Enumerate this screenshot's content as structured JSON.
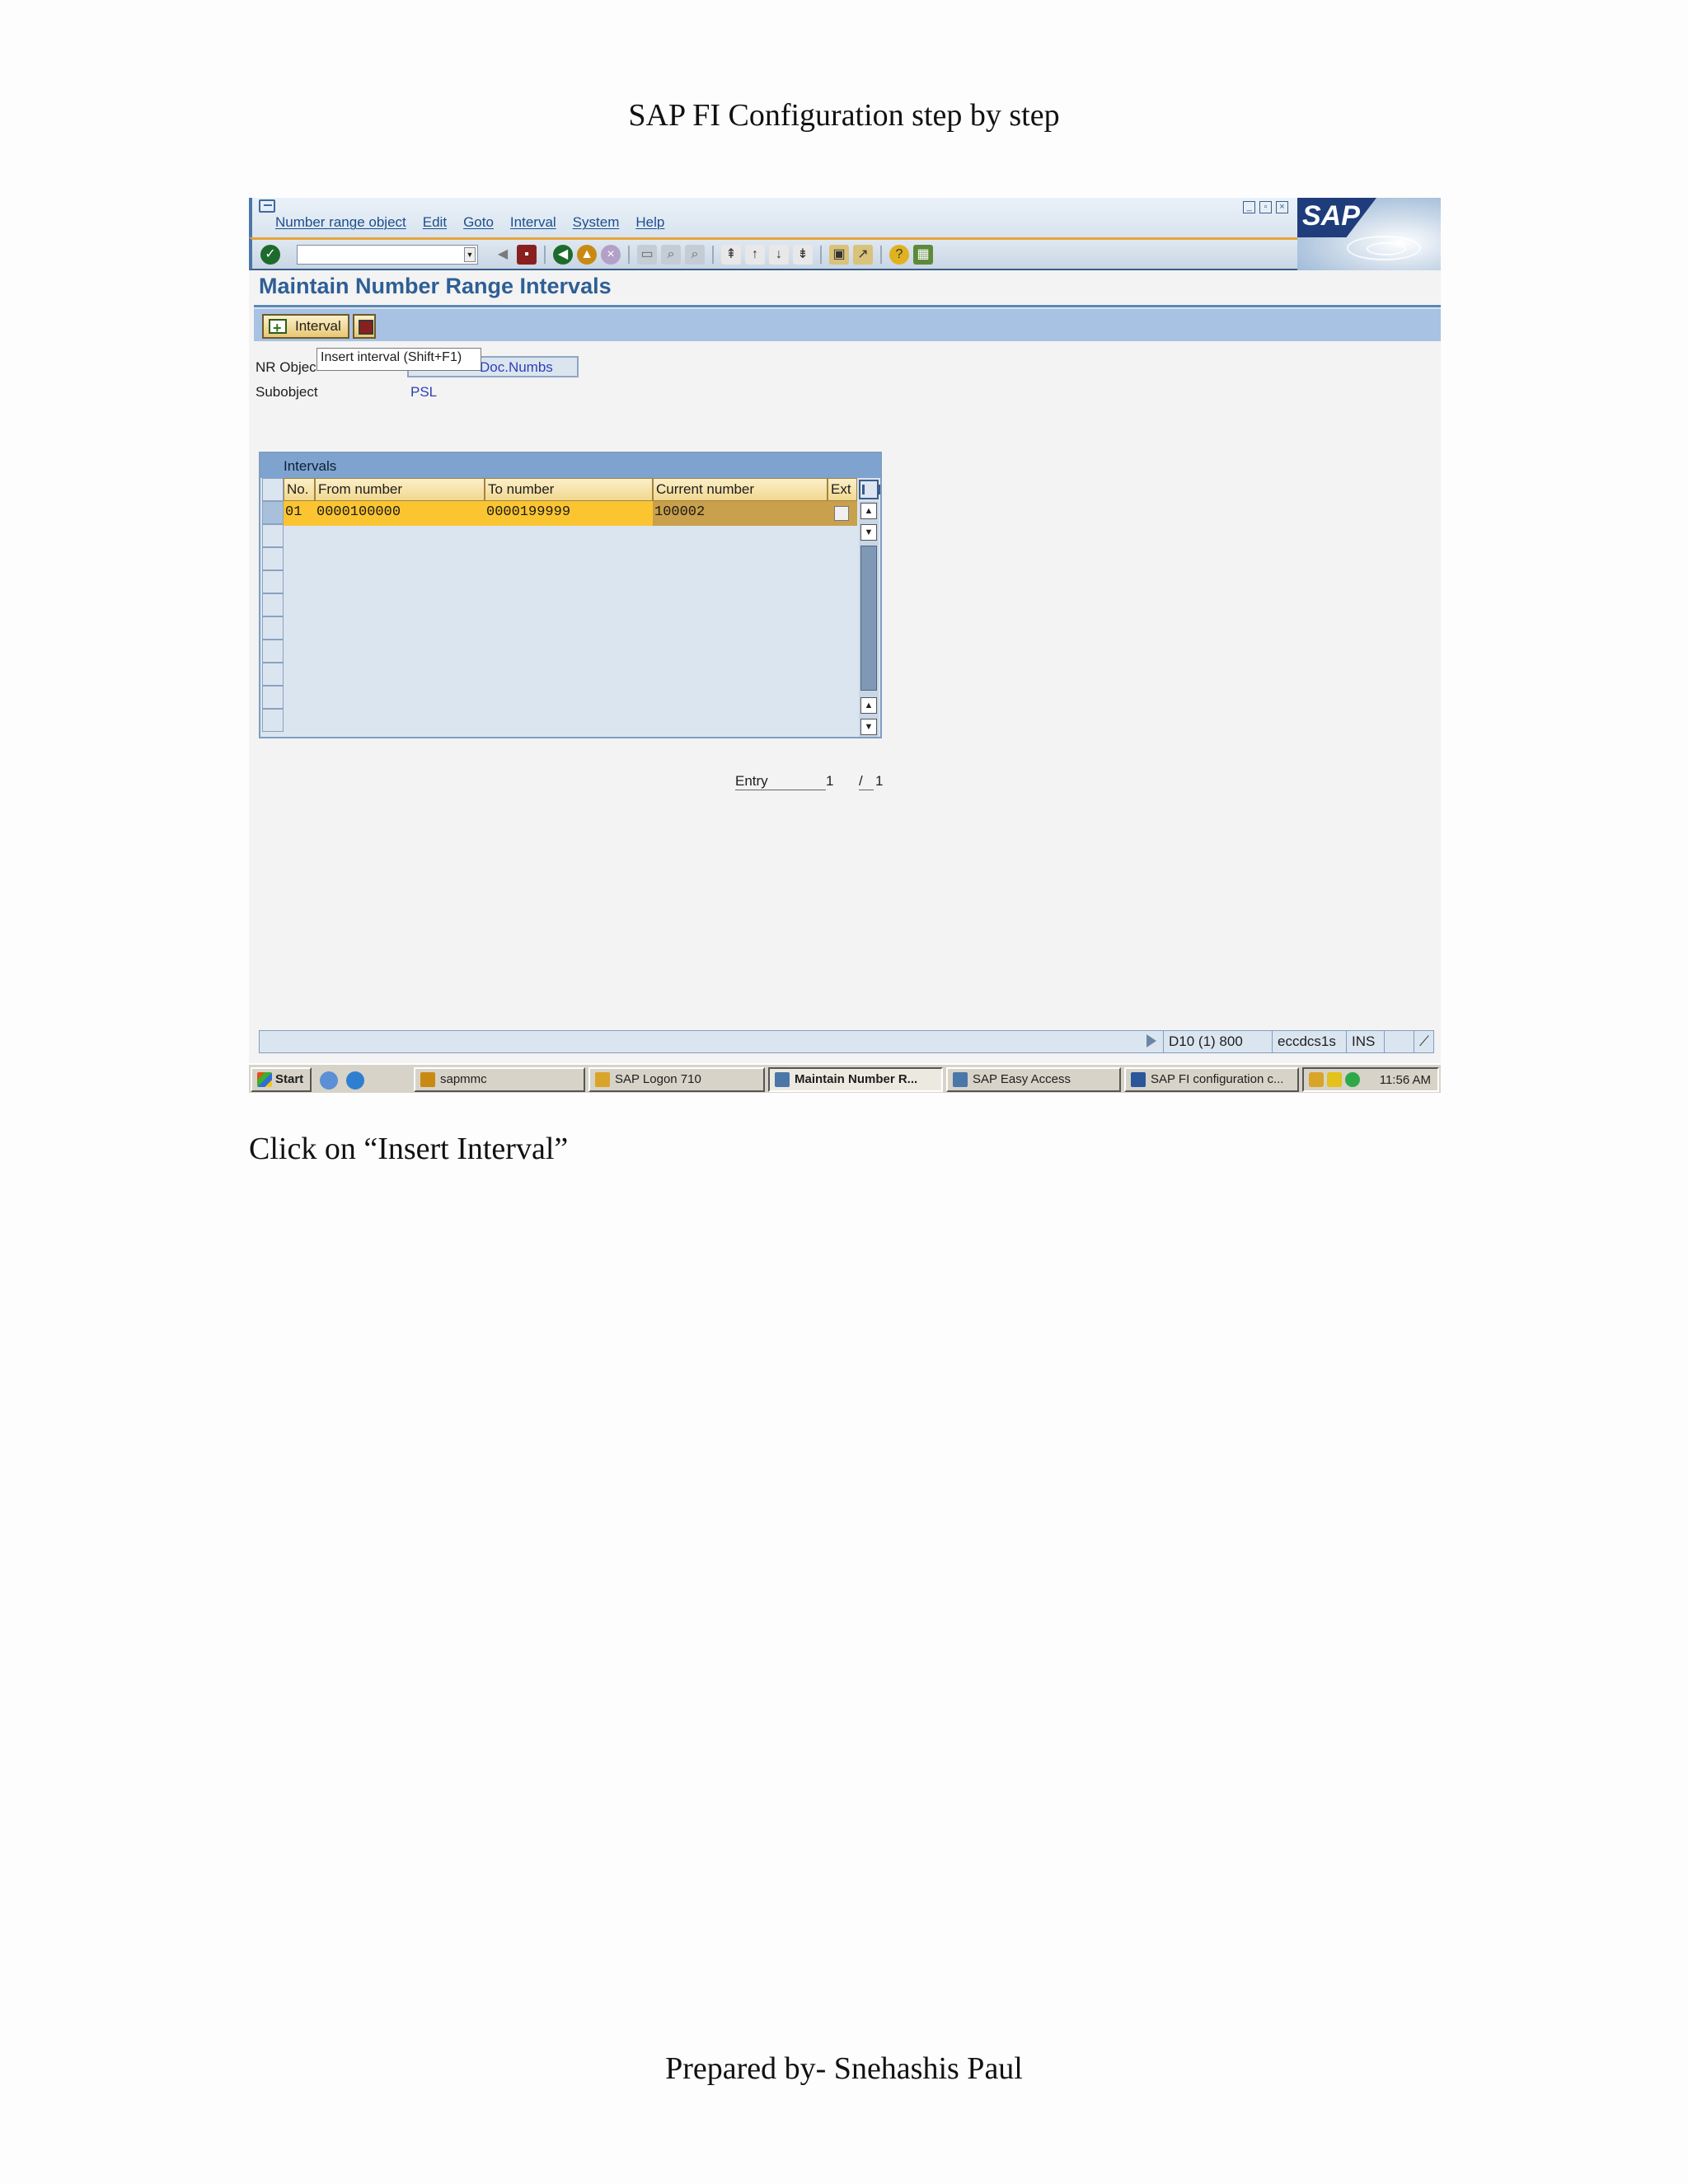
{
  "document": {
    "title": "SAP FI Configuration step by step",
    "caption": "Click on “Insert Interval”",
    "footer": "Prepared by- Snehashis Paul"
  },
  "sap": {
    "menu": [
      "Number range object",
      "Edit",
      "Goto",
      "Interval",
      "System",
      "Help"
    ],
    "logo_text": "SAP",
    "page_title": "Maintain Number Range Intervals",
    "interval_button_label": "Interval",
    "tooltip": "Insert interval    (Shift+F1)",
    "nr_object_label": "NR Objec",
    "nr_object_value": "Doc.Numbs",
    "subobject_label": "Subobject",
    "subobject_value": "PSL",
    "table": {
      "title": "Intervals",
      "columns": [
        "No.",
        "From number",
        "To number",
        "Current number",
        "Ext"
      ],
      "rows": [
        {
          "no": "01",
          "from": "0000100000",
          "to": "0000199999",
          "current": "100002",
          "ext": false
        }
      ]
    },
    "entry": {
      "label": "Entry",
      "current": "1",
      "sep": "/",
      "total": "1"
    },
    "status": {
      "system": "D10 (1) 800",
      "server": "eccdcs1s",
      "mode": "INS"
    }
  },
  "taskbar": {
    "start_label": "Start",
    "buttons": [
      "sapmmc",
      "SAP Logon 710",
      "Maintain Number R...",
      "SAP Easy Access",
      "SAP FI configuration c..."
    ],
    "active_index": 2,
    "time": "11:56 AM"
  },
  "colors": {
    "sap_blue": "#2e5f95",
    "row_highlight": "#fbc531",
    "appbar": "#a8c2e4"
  }
}
